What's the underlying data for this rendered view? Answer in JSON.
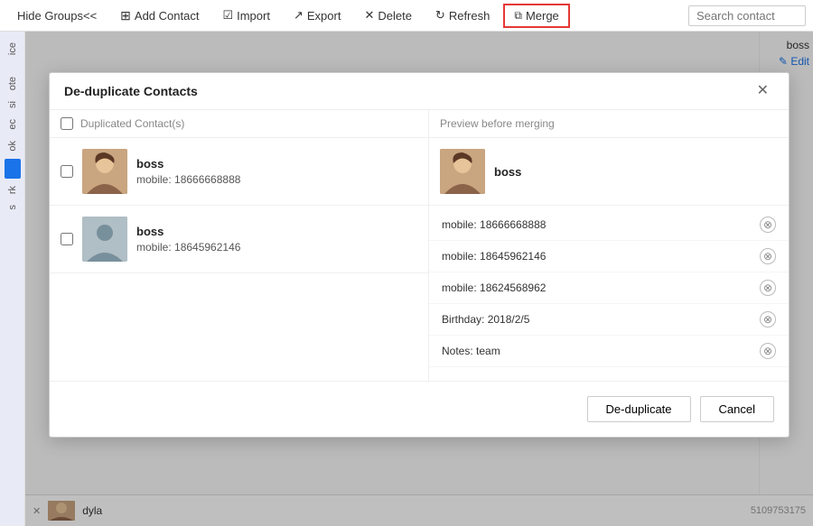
{
  "toolbar": {
    "hide_groups_label": "Hide Groups<<",
    "add_contact_label": "Add Contact",
    "import_label": "Import",
    "export_label": "Export",
    "delete_label": "Delete",
    "refresh_label": "Refresh",
    "merge_label": "Merge",
    "search_placeholder": "Search contact"
  },
  "modal": {
    "title": "De-duplicate Contacts",
    "left_col_header": "Duplicated Contact(s)",
    "right_col_header": "Preview before merging",
    "contacts": [
      {
        "name": "boss",
        "detail": "mobile: 18666668888",
        "has_photo": true
      },
      {
        "name": "boss",
        "detail": "mobile: 18645962146",
        "has_photo": false
      }
    ],
    "preview": {
      "name": "boss",
      "details": [
        "mobile: 18666668888",
        "mobile: 18645962146",
        "mobile: 18624568962",
        "Birthday: 2018/2/5",
        "Notes: team"
      ]
    },
    "dedup_button": "De-duplicate",
    "cancel_button": "Cancel"
  },
  "background": {
    "right_panel_text": "boss",
    "edit_label": "Edit",
    "bottom_contact_name": "dyla"
  },
  "icons": {
    "close": "✕",
    "add": "+",
    "person": "👤",
    "remove_circle": "⊗"
  }
}
